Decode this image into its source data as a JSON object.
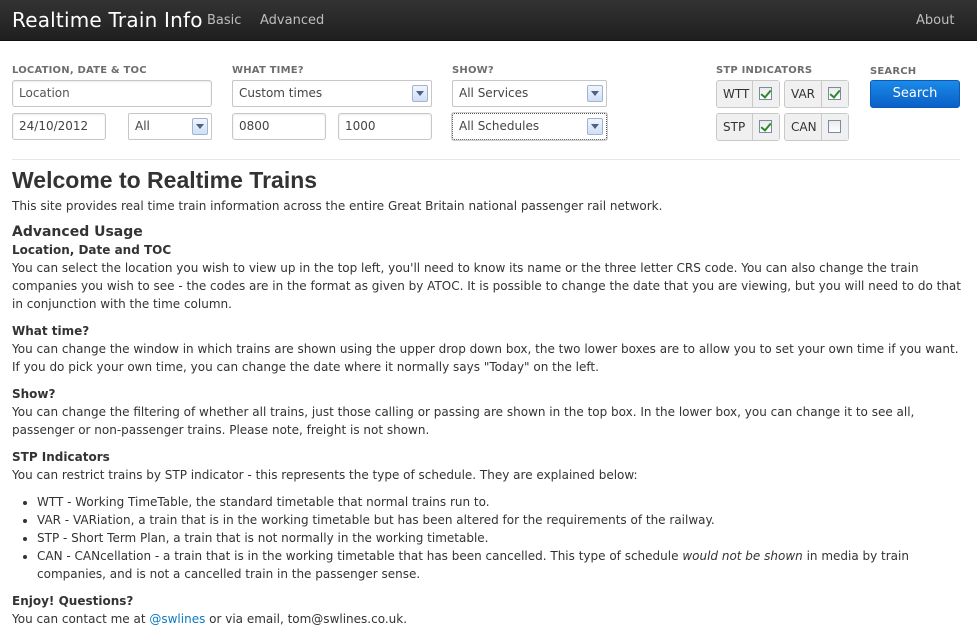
{
  "navbar": {
    "brand": "Realtime Train Info",
    "links": [
      "Basic",
      "Advanced"
    ],
    "right_link": "About"
  },
  "form": {
    "location_label": "LOCATION, DATE & TOC",
    "location_placeholder": "Location",
    "date_value": "24/10/2012",
    "toc_selected": "All",
    "time_label": "WHAT TIME?",
    "time_selected": "Custom times",
    "time_from": "0800",
    "time_to": "1000",
    "show_label": "SHOW?",
    "services_selected": "All Services",
    "schedules_selected": "All Schedules",
    "stp_label": "STP INDICATORS",
    "stp": [
      {
        "label": "WTT",
        "checked": true
      },
      {
        "label": "VAR",
        "checked": true
      },
      {
        "label": "STP",
        "checked": true
      },
      {
        "label": "CAN",
        "checked": false
      }
    ],
    "search_label": "SEARCH",
    "search_button": "Search"
  },
  "content": {
    "title": "Welcome to Realtime Trains",
    "intro": "This site provides real time train information across the entire Great Britain national passenger rail network.",
    "advanced_heading": "Advanced Usage",
    "sections": [
      {
        "heading": "Location, Date and TOC",
        "text": "You can select the location you wish to view up in the top left, you'll need to know its name or the three letter CRS code. You can also change the train companies you wish to see - the codes are in the format as given by ATOC. It is possible to change the date that you are viewing, but you will need to do that in conjunction with the time column."
      },
      {
        "heading": "What time?",
        "text": "You can change the window in which trains are shown using the upper drop down box, the two lower boxes are to allow you to set your own time if you want. If you do pick your own time, you can change the date where it normally says \"Today\" on the left."
      },
      {
        "heading": "Show?",
        "text": "You can change the filtering of whether all trains, just those calling or passing are shown in the top box. In the lower box, you can change it to see all, passenger or non-passenger trains. Please note, freight is not shown."
      },
      {
        "heading": "STP Indicators",
        "text": "You can restrict trains by STP indicator - this represents the type of schedule. They are explained below:"
      }
    ],
    "stp_list": [
      "WTT - Working TimeTable, the standard timetable that normal trains run to.",
      "VAR - VARiation, a train that is in the working timetable but has been altered for the requirements of the railway.",
      "STP - Short Term Plan, a train that is not normally in the working timetable."
    ],
    "can_item": {
      "prefix": "CAN - CANcellation - a train that is in the working timetable that has been cancelled. This type of schedule ",
      "emphasis": "would not be shown",
      "suffix": " in media by train companies, and is not a cancelled train in the passenger sense."
    },
    "closing_heading": "Enjoy! Questions?",
    "contact_prefix": "You can contact me at ",
    "contact_link": "@swlines",
    "contact_suffix": " or via email, tom@swlines.co.uk."
  }
}
